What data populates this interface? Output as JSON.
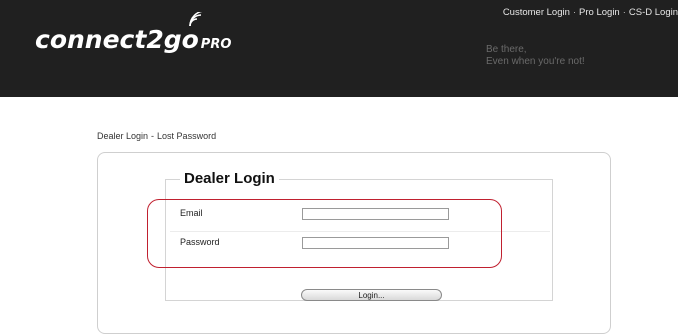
{
  "header": {
    "logo_text": "connect2go",
    "logo_suffix": "PRO",
    "top_links": [
      "Customer Login",
      "Pro Login",
      "CS-D Login"
    ],
    "separator": "·",
    "tagline_line1": "Be there,",
    "tagline_line2": "Even when you're not!"
  },
  "breadcrumb": {
    "item1": "Dealer Login",
    "separator": "-",
    "item2": "Lost Password"
  },
  "form": {
    "legend": "Dealer Login",
    "email_label": "Email",
    "email_value": "",
    "password_label": "Password",
    "password_value": "",
    "submit_label": "Login..."
  },
  "colors": {
    "header_bg": "#202020",
    "highlight": "#c0202f"
  },
  "icons": {
    "logo_signal": "wifi-signal-icon"
  }
}
